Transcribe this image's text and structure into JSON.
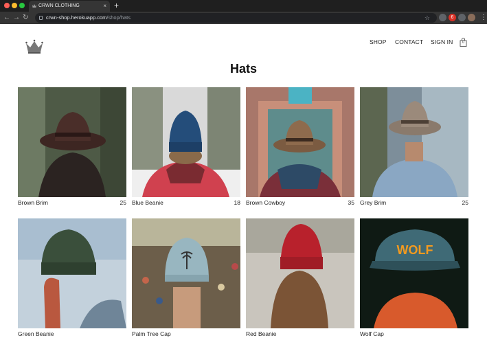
{
  "browser": {
    "tab_title": "CRWN CLOTHING",
    "tab_close": "×",
    "new_tab": "+",
    "url_host": "crwn-shop.herokuapp.com",
    "url_path": "/shop/hats",
    "back": "←",
    "forward": "→",
    "reload": "↻",
    "bookmark": "☆",
    "extension_badge": "6",
    "menu": "⋮"
  },
  "header": {
    "nav": [
      "SHOP",
      "CONTACT",
      "SIGN IN"
    ],
    "cart_count": "0"
  },
  "page": {
    "title": "Hats"
  },
  "items": [
    {
      "name": "Brown Brim",
      "price": "25"
    },
    {
      "name": "Blue Beanie",
      "price": "18"
    },
    {
      "name": "Brown Cowboy",
      "price": "35"
    },
    {
      "name": "Grey Brim",
      "price": "25"
    },
    {
      "name": "Green Beanie",
      "price": ""
    },
    {
      "name": "Palm Tree Cap",
      "price": ""
    },
    {
      "name": "Red Beanie",
      "price": ""
    },
    {
      "name": "Wolf Cap",
      "price": ""
    }
  ],
  "colors": {
    "chrome_bg": "#1f1f1f",
    "toolbar_bg": "#353535",
    "text": "#222222"
  }
}
